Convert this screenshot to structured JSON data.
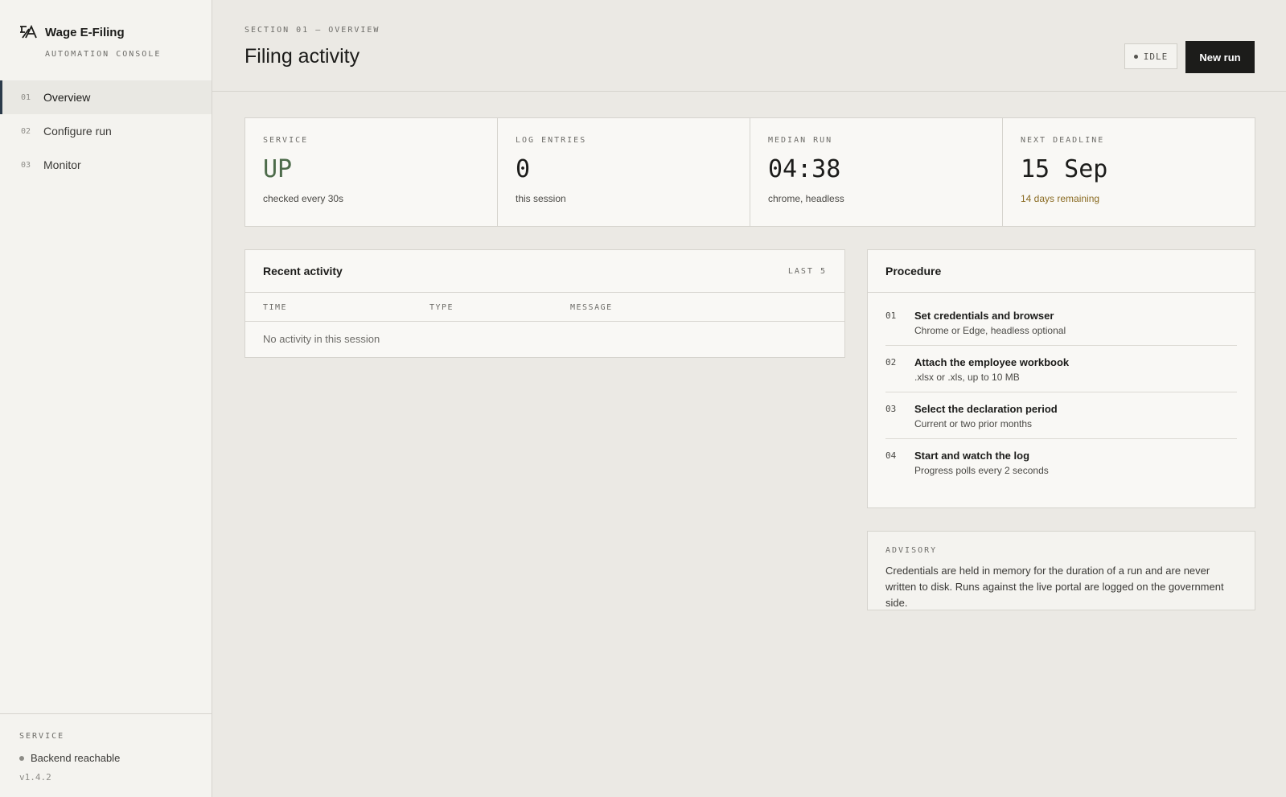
{
  "brand": {
    "title": "Wage E-Filing",
    "subtitle": "AUTOMATION CONSOLE"
  },
  "nav": [
    {
      "num": "01",
      "label": "Overview"
    },
    {
      "num": "02",
      "label": "Configure run"
    },
    {
      "num": "03",
      "label": "Monitor"
    }
  ],
  "sidebar_footer": {
    "label": "SERVICE",
    "status": "Backend reachable",
    "version": "v1.4.2"
  },
  "header": {
    "eyebrow": "SECTION 01 — OVERVIEW",
    "title": "Filing activity",
    "status_badge": "IDLE",
    "new_run_label": "New run"
  },
  "stats": [
    {
      "label": "SERVICE",
      "value": "UP",
      "note": "checked every 30s"
    },
    {
      "label": "LOG ENTRIES",
      "value": "0",
      "note": "this session"
    },
    {
      "label": "MEDIAN RUN",
      "value": "04:38",
      "note": "chrome, headless"
    },
    {
      "label": "NEXT DEADLINE",
      "value": "15 Sep",
      "note": "14 days remaining"
    }
  ],
  "activity": {
    "title": "Recent activity",
    "meta": "LAST 5",
    "columns": [
      "TIME",
      "TYPE",
      "MESSAGE"
    ],
    "empty": "No activity in this session"
  },
  "procedure": {
    "title": "Procedure",
    "steps": [
      {
        "num": "01",
        "title": "Set credentials and browser",
        "desc": "Chrome or Edge, headless optional"
      },
      {
        "num": "02",
        "title": "Attach the employee workbook",
        "desc": ".xlsx or .xls, up to 10 MB"
      },
      {
        "num": "03",
        "title": "Select the declaration period",
        "desc": "Current or two prior months"
      },
      {
        "num": "04",
        "title": "Start and watch the log",
        "desc": "Progress polls every 2 seconds"
      }
    ]
  },
  "advisory": {
    "label": "ADVISORY",
    "text": "Credentials are held in memory for the duration of a run and are never written to disk. Runs against the live portal are logged on the government side."
  },
  "colors": {
    "accent_dark": "#1c1c1a",
    "status_ok": "#4d6b4a",
    "status_warn": "#8a6b22",
    "active_nav_bar": "#2b3a4a"
  }
}
